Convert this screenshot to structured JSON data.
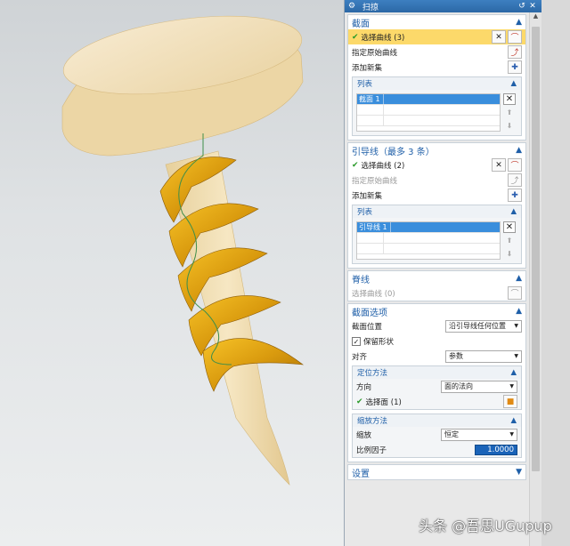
{
  "titlebar": {
    "icon": "⚙",
    "title": "扫掠",
    "reset": "↺",
    "close": "✕"
  },
  "section_sections": {
    "title": "截面",
    "select_curve": "选择曲线 (3)",
    "specify_origin": "指定原始曲线",
    "add_new_set": "添加新集",
    "list_title": "列表",
    "list_items": [
      "截面 1"
    ]
  },
  "section_guides": {
    "title": "引导线（最多 3 条）",
    "select_curve": "选择曲线 (2)",
    "specify_origin": "指定原始曲线",
    "add_new_set": "添加新集",
    "list_title": "列表",
    "list_items": [
      "引导线 1"
    ]
  },
  "section_spine": {
    "title": "脊线",
    "select_curve": "选择曲线 (0)"
  },
  "section_options": {
    "title": "截面选项",
    "position_label": "截面位置",
    "position_value": "沿引导线任何位置",
    "preserve_shape": "保留形状",
    "align_label": "对齐",
    "align_value": "参数",
    "orientation": {
      "title": "定位方法",
      "direction_label": "方向",
      "direction_value": "面的法向",
      "select_face": "选择面 (1)"
    },
    "scaling": {
      "title": "缩放方法",
      "scale_label": "缩放",
      "scale_value": "恒定",
      "factor_label": "比例因子",
      "factor_value": "1.0000"
    }
  },
  "section_settings": {
    "title": "设置"
  },
  "watermark": {
    "text": "头条 @吾思UGupup"
  },
  "colors": {
    "accent": "#1f5fa8",
    "highlight": "#fcd96a",
    "selection": "#3a8edc",
    "screw_body": "#efdcb0",
    "thread": "#e2a612"
  }
}
